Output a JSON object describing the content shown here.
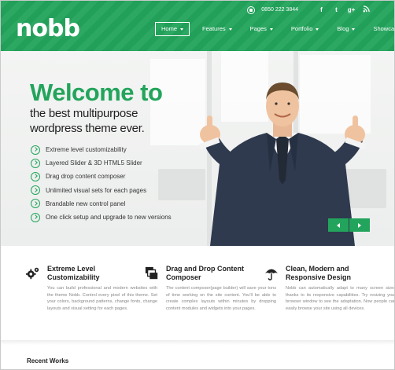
{
  "brand": {
    "logo": "nobb",
    "accent": "#23a45c"
  },
  "topbar": {
    "phone": "0850 222 3844",
    "social": [
      "f",
      "t",
      "g+",
      "rss"
    ]
  },
  "nav": {
    "items": [
      {
        "label": "Home",
        "dropdown": true,
        "active": true
      },
      {
        "label": "Features",
        "dropdown": true
      },
      {
        "label": "Pages",
        "dropdown": true
      },
      {
        "label": "Portfolio",
        "dropdown": true
      },
      {
        "label": "Blog",
        "dropdown": true
      },
      {
        "label": "Showcase",
        "dropdown": false
      }
    ]
  },
  "hero": {
    "heading": "Welcome to",
    "tagline_line1": "the best multipurpose",
    "tagline_line2": "wordpress theme ever.",
    "features": [
      "Extreme level customizability",
      "Layered Slider & 3D HTML5 Slider",
      "Drag drop content composer",
      "Unlimited visual sets for each pages",
      "Brandable new control panel",
      "One click setup and upgrade to new versions"
    ],
    "slider_prev_icon": "arrow-left-icon",
    "slider_next_icon": "arrow-right-icon"
  },
  "columns": [
    {
      "icon": "gears-icon",
      "title_line1": "Extreme Level",
      "title_line2": "Customizability",
      "text": "You can build professional and modern websites with the theme Nobb. Control every pixel of this theme. Set your colors, background patterns, change fonts, change layouts and visual setting for each pages."
    },
    {
      "icon": "layers-icon",
      "title_line1": "Drag and Drop Content",
      "title_line2": "Composer",
      "text": "The content composer(page builder) will save your tons of time working on the site content. You'll be able to create complex layouts within minutes by dropping content modules and widgets into your pages."
    },
    {
      "icon": "umbrella-icon",
      "title_line1": "Clean, Modern and",
      "title_line2": "Responsive Design",
      "text": "Nobb can automatically adapt to many screen sizes thanks to its responsive capabilities. Try resizing your browser window to see the adaptation. Now people can easily browse your site using all devices."
    }
  ],
  "recent_works": "Recent Works"
}
